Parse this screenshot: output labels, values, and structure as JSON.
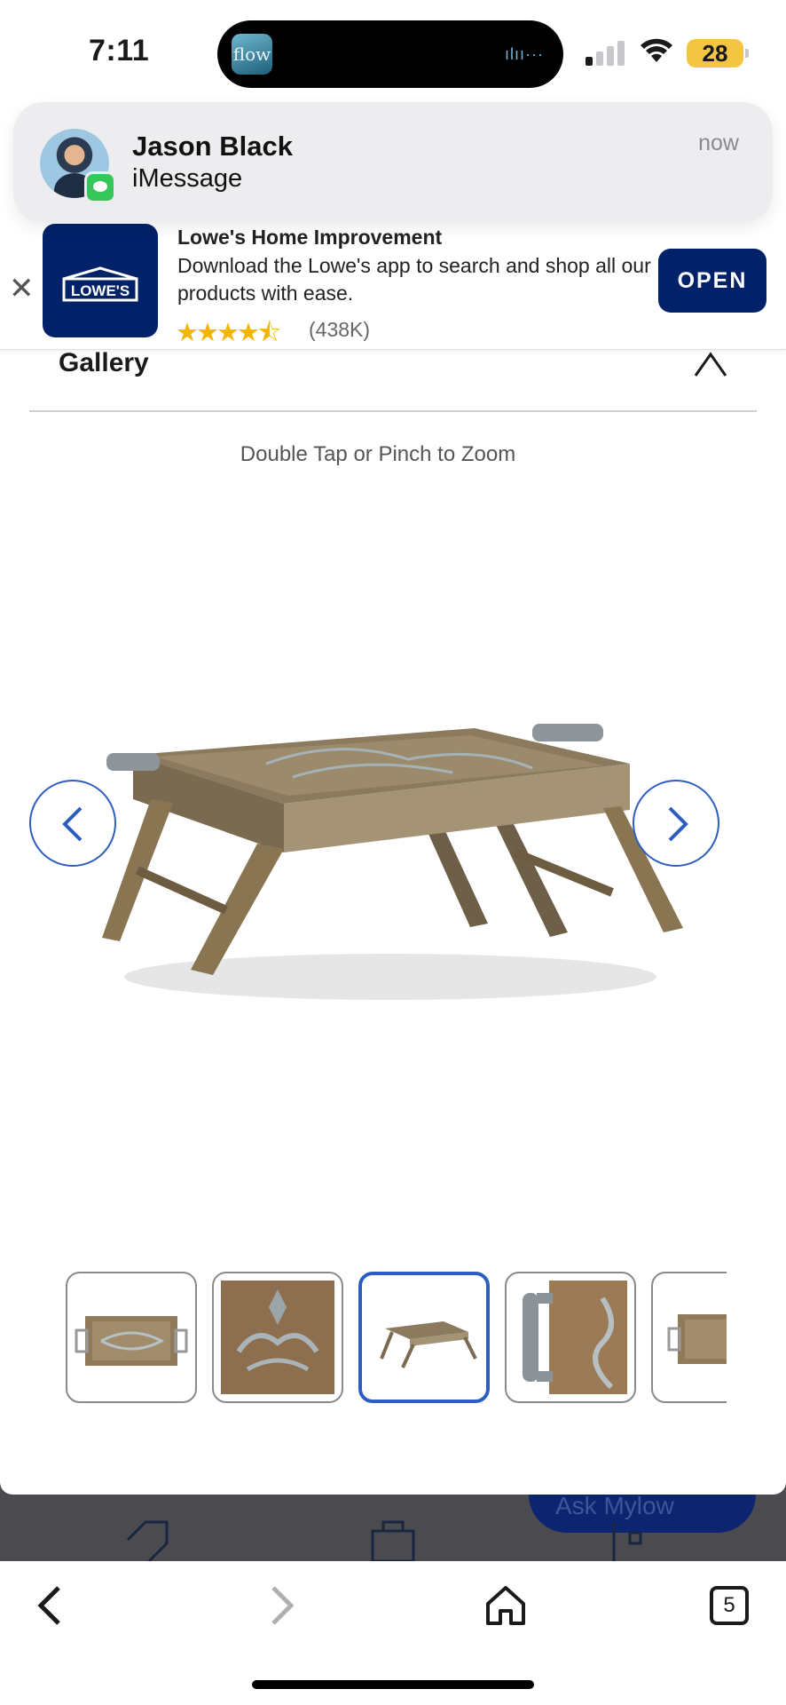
{
  "status_bar": {
    "time": "7:11",
    "live_activity_app": "flow",
    "battery_level": "28",
    "signal_bars_active": 1,
    "signal_bars_total": 4
  },
  "notification": {
    "sender": "Jason  Black",
    "app": "iMessage",
    "time": "now"
  },
  "app_banner": {
    "title": "Lowe's Home Improvement",
    "description": "Download the Lowe's app to search and shop all our products with ease.",
    "logo_text": "LOWE'S",
    "rating_stars": 4.5,
    "rating_count": "(438K)",
    "open_label": "OPEN",
    "brand_color": "#012169"
  },
  "gallery": {
    "title": "Gallery",
    "hint": "Double Tap or Pinch to Zoom",
    "thumbnails": [
      {
        "label": "tray-top-view",
        "active": false
      },
      {
        "label": "inlay-detail",
        "active": false
      },
      {
        "label": "tray-with-legs",
        "active": true
      },
      {
        "label": "handle-detail",
        "active": false
      },
      {
        "label": "tray-partial",
        "active": false
      }
    ],
    "accent_color": "#2d5ebf"
  },
  "background_page": {
    "ask_button_label": "Ask Mylow"
  },
  "toolbar": {
    "tabs_count": "5"
  }
}
